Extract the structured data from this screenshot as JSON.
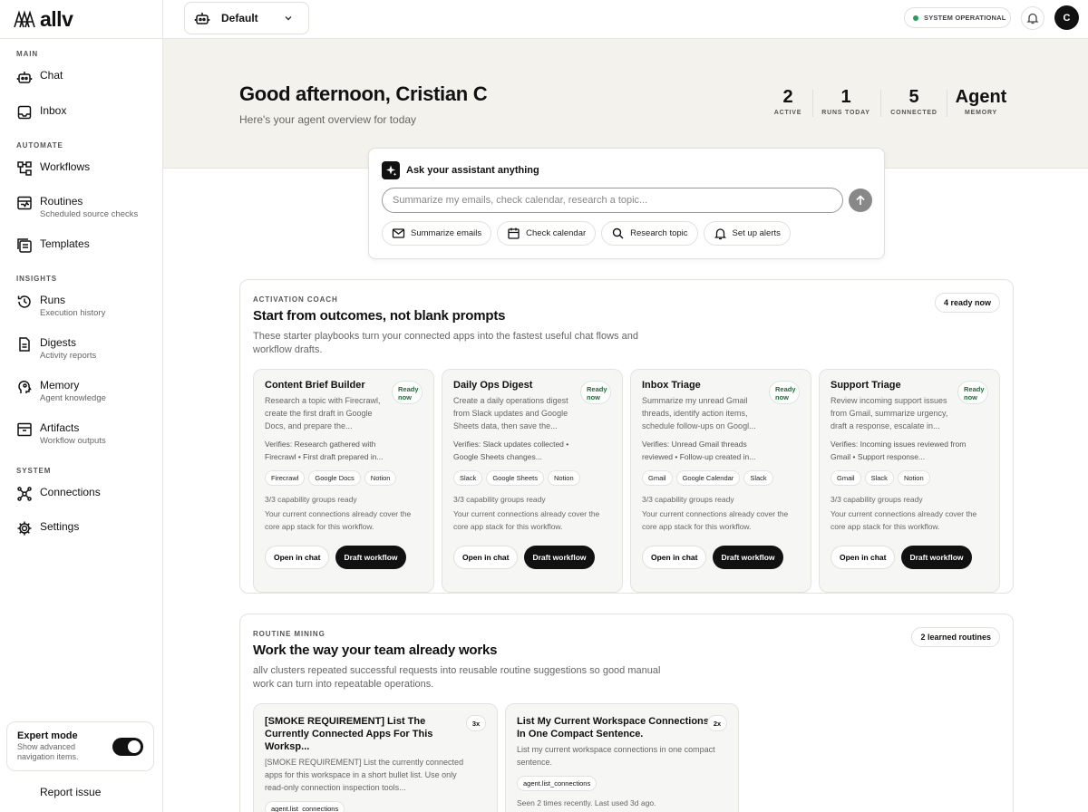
{
  "app": {
    "logo_text": "allv"
  },
  "sidebar": {
    "sections": [
      {
        "label": "MAIN"
      },
      {
        "label": "AUTOMATE"
      },
      {
        "label": "INSIGHTS"
      },
      {
        "label": "SYSTEM"
      }
    ],
    "items": [
      {
        "label": "Chat",
        "sub": "",
        "icon": "robot-icon"
      },
      {
        "label": "Inbox",
        "sub": "",
        "icon": "inbox-icon"
      },
      {
        "label": "Workflows",
        "sub": "",
        "icon": "workflow-icon"
      },
      {
        "label": "Routines",
        "sub": "Scheduled source checks",
        "icon": "routine-icon"
      },
      {
        "label": "Templates",
        "sub": "",
        "icon": "templates-icon"
      },
      {
        "label": "Runs",
        "sub": "Execution history",
        "icon": "history-icon"
      },
      {
        "label": "Digests",
        "sub": "Activity reports",
        "icon": "digest-icon"
      },
      {
        "label": "Memory",
        "sub": "Agent knowledge",
        "icon": "brain-icon"
      },
      {
        "label": "Artifacts",
        "sub": "Workflow outputs",
        "icon": "archive-icon"
      },
      {
        "label": "Connections",
        "sub": "",
        "icon": "connections-icon"
      },
      {
        "label": "Settings",
        "sub": "",
        "icon": "gear-icon"
      }
    ],
    "expert_mode": {
      "title": "Expert mode",
      "desc": "Show advanced navigation items.",
      "enabled": true
    },
    "report_issue": "Report issue"
  },
  "topbar": {
    "workspace": "Default",
    "status": "SYSTEM OPERATIONAL",
    "status_color": "#22a05a",
    "avatar_initial": "C"
  },
  "hero": {
    "greeting": "Good afternoon, Cristian C",
    "subtitle": "Here's your agent overview for today",
    "stats": [
      {
        "value": "2",
        "label": "ACTIVE"
      },
      {
        "value": "1",
        "label": "RUNS TODAY"
      },
      {
        "value": "5",
        "label": "CONNECTED"
      },
      {
        "value": "Agent",
        "label": "MEMORY"
      }
    ]
  },
  "assistant": {
    "title": "Ask your assistant anything",
    "placeholder": "Summarize my emails, check calendar, research a topic...",
    "chips": [
      {
        "label": "Summarize emails",
        "icon": "mail-icon"
      },
      {
        "label": "Check calendar",
        "icon": "calendar-icon"
      },
      {
        "label": "Research topic",
        "icon": "search-icon"
      },
      {
        "label": "Set up alerts",
        "icon": "bell-icon"
      }
    ]
  },
  "activation": {
    "eyebrow": "ACTIVATION COACH",
    "title": "Start from outcomes, not blank prompts",
    "desc": "These starter playbooks turn your connected apps into the fastest useful chat flows and workflow drafts.",
    "badge": "4 ready now",
    "cards": [
      {
        "title": "Content Brief Builder",
        "ready": "Ready now",
        "desc": "Research a topic with Firecrawl, create the first draft in Google Docs, and prepare the...",
        "verifies": "Verifies: Research gathered with Firecrawl • First draft prepared in...",
        "tags": [
          "Firecrawl",
          "Google Docs",
          "Notion"
        ],
        "capability": "3/3 capability groups ready",
        "cover": "Your current connections already cover the core app stack for this workflow.",
        "open_label": "Open in chat",
        "draft_label": "Draft workflow"
      },
      {
        "title": "Daily Ops Digest",
        "ready": "Ready now",
        "desc": "Create a daily operations digest from Slack updates and Google Sheets data, then save the...",
        "verifies": "Verifies: Slack updates collected • Google Sheets changes...",
        "tags": [
          "Slack",
          "Google Sheets",
          "Notion"
        ],
        "capability": "3/3 capability groups ready",
        "cover": "Your current connections already cover the core app stack for this workflow.",
        "open_label": "Open in chat",
        "draft_label": "Draft workflow"
      },
      {
        "title": "Inbox Triage",
        "ready": "Ready now",
        "desc": "Summarize my unread Gmail threads, identify action items, schedule follow-ups on Googl...",
        "verifies": "Verifies: Unread Gmail threads reviewed • Follow-up created in...",
        "tags": [
          "Gmail",
          "Google Calendar",
          "Slack"
        ],
        "capability": "3/3 capability groups ready",
        "cover": "Your current connections already cover the core app stack for this workflow.",
        "open_label": "Open in chat",
        "draft_label": "Draft workflow"
      },
      {
        "title": "Support Triage",
        "ready": "Ready now",
        "desc": "Review incoming support issues from Gmail, summarize urgency, draft a response, escalate in...",
        "verifies": "Verifies: Incoming issues reviewed from Gmail • Support response...",
        "tags": [
          "Gmail",
          "Slack",
          "Notion"
        ],
        "capability": "3/3 capability groups ready",
        "cover": "Your current connections already cover the core app stack for this workflow.",
        "open_label": "Open in chat",
        "draft_label": "Draft workflow"
      }
    ]
  },
  "routines": {
    "eyebrow": "ROUTINE MINING",
    "title": "Work the way your team already works",
    "desc": "allv clusters repeated successful requests into reusable routine suggestions so good manual work can turn into repeatable operations.",
    "badge": "2 learned routines",
    "cards": [
      {
        "title": "[SMOKE REQUIREMENT] List The Currently Connected Apps For This Worksp...",
        "count": "3x",
        "desc": "[SMOKE REQUIREMENT] List the currently connected apps for this workspace in a short bullet list. Use only read-only connection inspection tools...",
        "tag": "agent.list_connections",
        "seen": ""
      },
      {
        "title": "List My Current Workspace Connections In One Compact Sentence.",
        "count": "2x",
        "desc": "List my current workspace connections in one compact sentence.",
        "tag": "agent.list_connections",
        "seen": "Seen 2 times recently. Last used 3d ago."
      }
    ]
  }
}
